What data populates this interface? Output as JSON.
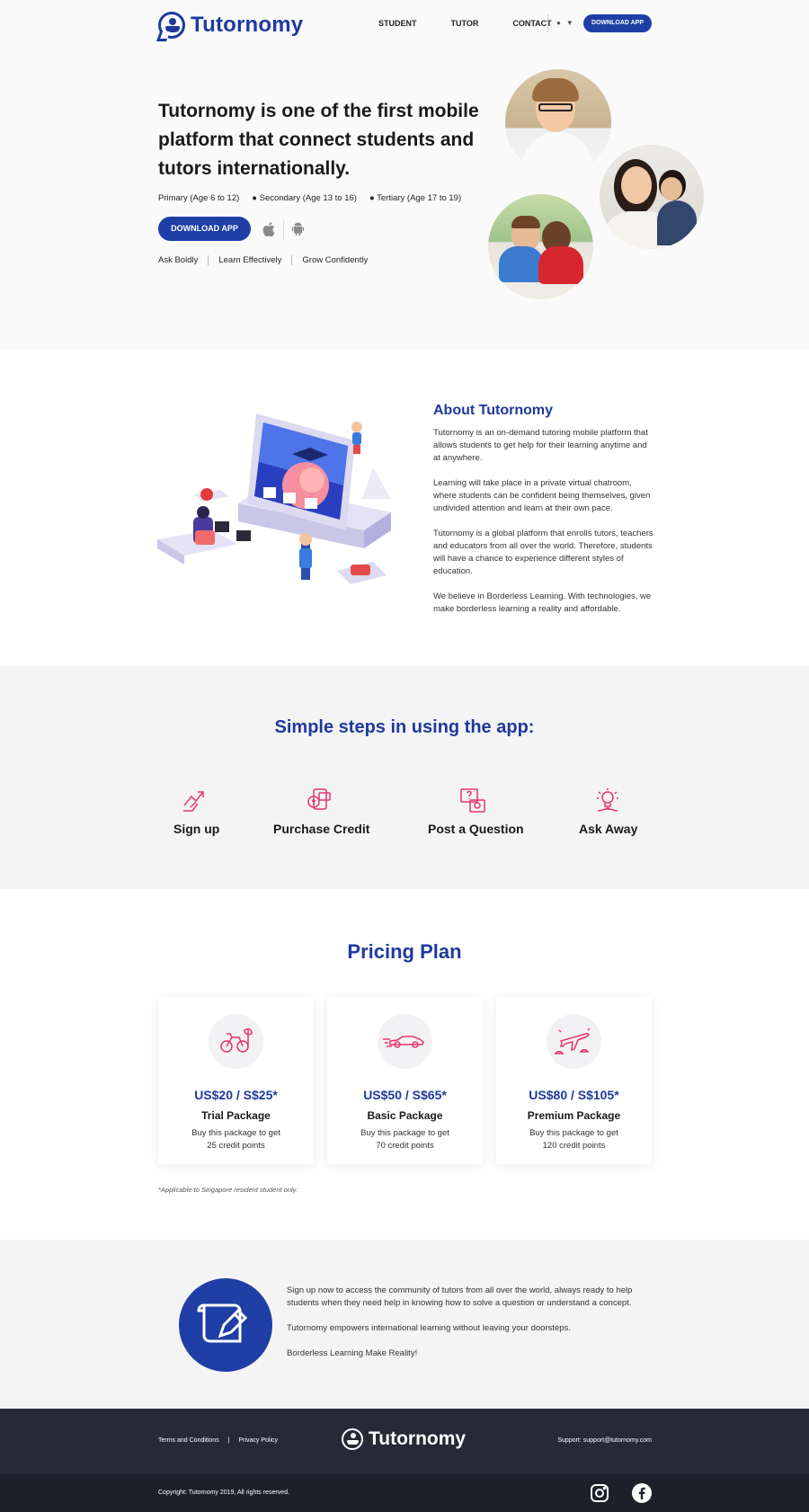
{
  "nav": {
    "logo_text": "Tutornomy",
    "links": [
      "STUDENT",
      "TUTOR",
      "CONTACT"
    ],
    "download_label": "DOWNLOAD APP",
    "os_icons": [
      "apple-icon",
      "android-icon"
    ]
  },
  "hero": {
    "title": "Tutornomy is one of the first mobile platform that connect students and tutors internationally.",
    "levels": [
      "Primary (Age 6 to 12)",
      "● Secondary (Age 13 to 16)",
      "● Tertiary (Age 17 to 19)"
    ],
    "download_label": "DOWNLOAD APP",
    "taglines": [
      "Ask Boldly",
      "Learn Effectively",
      "Grow Confidently"
    ]
  },
  "about": {
    "title": "About Tutornomy",
    "paragraphs": [
      "Tutornomy is an on-demand tutoring mobile platform that allows students to get help for their learning anytime and at anywhere.",
      "Learning will take place in a private virtual chatroom, where students can be confident being themselves, given undivided attention and learn at their own pace.",
      "Tutornomy is a global platform that enrolls tutors, teachers and educators from all over the world. Therefore, students will have a chance to experience different styles of education.",
      "We believe in Borderless Learning. With technologies, we make borderless learning a reality and affordable."
    ]
  },
  "steps": {
    "title": "Simple steps in using the app:",
    "items": [
      {
        "label": "Sign up",
        "icon": "signup-icon"
      },
      {
        "label": "Purchase Credit",
        "icon": "credit-icon"
      },
      {
        "label": "Post a Question",
        "icon": "question-icon"
      },
      {
        "label": "Ask Away",
        "icon": "lightbulb-icon"
      }
    ]
  },
  "pricing": {
    "title": "Pricing Plan",
    "plans": [
      {
        "price": "US$20 / S$25*",
        "name": "Trial Package",
        "desc1": "Buy this package to get",
        "desc2": "25 credit points",
        "icon": "bicycle-icon"
      },
      {
        "price": "US$50 / S$65*",
        "name": "Basic Package",
        "desc1": "Buy this package to get",
        "desc2": "70 credit points",
        "icon": "car-icon"
      },
      {
        "price": "US$80 / S$105*",
        "name": "Premium Package",
        "desc1": "Buy this package to get",
        "desc2": "120 credit points",
        "icon": "airplane-icon"
      }
    ],
    "note": "*Applicable to Singapore resident student only."
  },
  "cta": {
    "paragraphs": [
      "Sign up now to access the community of tutors from all over the world, always ready to help students when they need help in knowing how to solve a question or understand a concept.",
      "Tutornomy empowers international learning without leaving your doorsteps.",
      "Borderless Learning Make Reality!"
    ]
  },
  "footer": {
    "terms": "Terms and Conditions",
    "divider": "|",
    "privacy": "Privacy Policy",
    "logo_text": "Tutornomy",
    "support": "Support: support@tutornomy.com",
    "copyright": "Copyright: Tutornomy 2019, All rights reserved."
  },
  "colors": {
    "brand_blue": "#1e3a9e",
    "accent_pink": "#e8336a",
    "footer_dark": "#262a37"
  }
}
